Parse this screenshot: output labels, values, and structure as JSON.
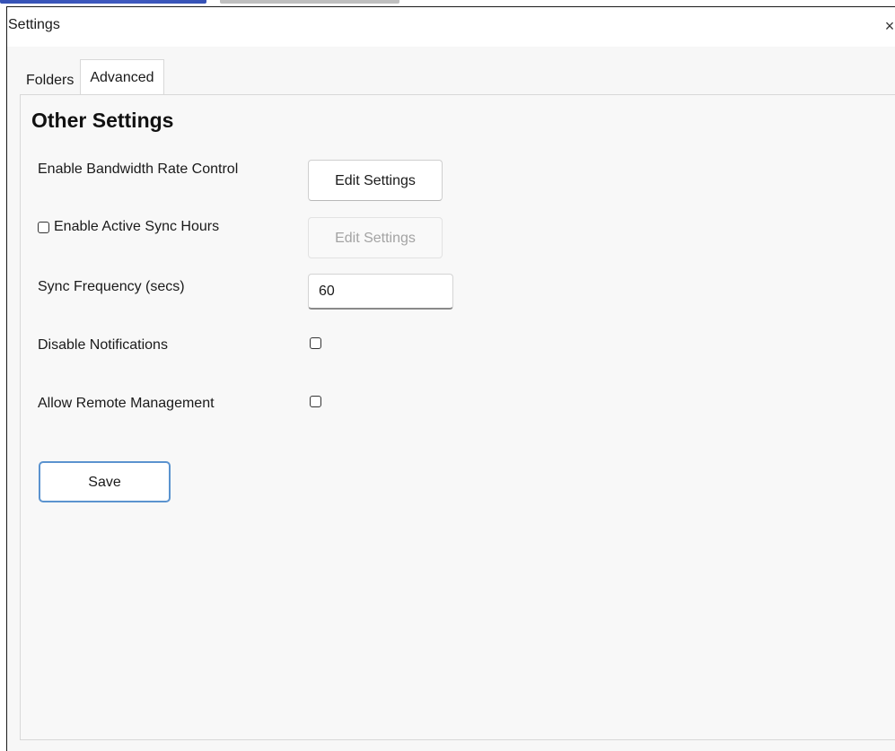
{
  "window": {
    "title": "Settings",
    "close_glyph": "×"
  },
  "tabs": [
    {
      "label": "Folders",
      "active": false
    },
    {
      "label": "Advanced",
      "active": true
    }
  ],
  "section": {
    "title": "Other Settings"
  },
  "rows": {
    "bandwidth": {
      "label": "Enable Bandwidth Rate Control",
      "button_label": "Edit Settings",
      "button_enabled": true
    },
    "active_sync": {
      "label": "Enable Active Sync Hours",
      "checked": false,
      "button_label": "Edit Settings",
      "button_enabled": false
    },
    "sync_frequency": {
      "label": "Sync Frequency (secs)",
      "value": "60"
    },
    "disable_notifications": {
      "label": "Disable Notifications",
      "checked": false
    },
    "remote_management": {
      "label": "Allow Remote Management",
      "checked": false
    }
  },
  "actions": {
    "save_label": "Save"
  },
  "colors": {
    "accent_border": "#5b93cf",
    "panel_bg": "#f8f8f8",
    "titlebar_bg": "#ffffff"
  }
}
